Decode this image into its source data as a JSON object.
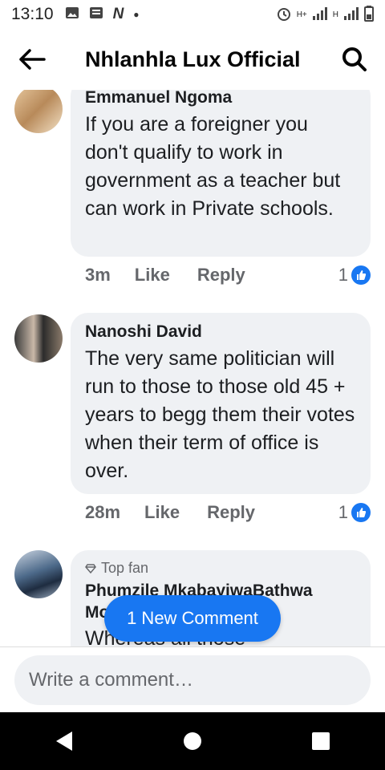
{
  "status_bar": {
    "time": "13:10",
    "network_label": "H+",
    "network_label_2": "H"
  },
  "header": {
    "title": "Nhlanhla Lux Official"
  },
  "comments": [
    {
      "author": "Emmanuel Ngoma",
      "text": "If you are a foreigner you don't qualify to work in government as a teacher but can work in Private schools.",
      "time": "3m",
      "like_label": "Like",
      "reply_label": "Reply",
      "like_count": "1"
    },
    {
      "author": "Nanoshi David",
      "text": "The very same politician will run to those to those old 45 + years to begg them their votes when their term of office is over.",
      "time": "28m",
      "like_label": "Like",
      "reply_label": "Reply",
      "like_count": "1"
    },
    {
      "badge": "Top fan",
      "author": "Phumzile MkabayiwaBathwa Mo",
      "text": "Whereas all those"
    }
  ],
  "new_comment_pill": "1 New Comment",
  "composer": {
    "placeholder": "Write a comment…"
  },
  "colors": {
    "accent": "#1877f2",
    "bubble": "#eff1f4",
    "secondary_text": "#65676b"
  }
}
